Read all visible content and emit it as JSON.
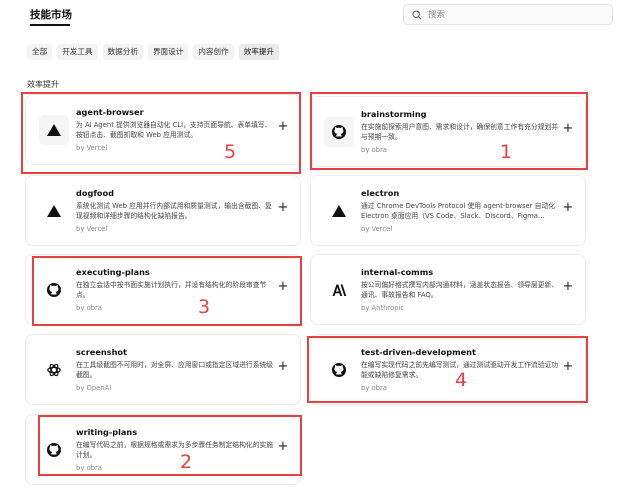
{
  "header": {
    "title": "技能市场"
  },
  "search": {
    "placeholder": "搜索",
    "icon": "search-icon"
  },
  "filters": [
    {
      "label": "全部",
      "active": false
    },
    {
      "label": "开发工具",
      "active": false
    },
    {
      "label": "数据分析",
      "active": false
    },
    {
      "label": "界面设计",
      "active": false
    },
    {
      "label": "内容创作",
      "active": false
    },
    {
      "label": "效率提升",
      "active": true
    }
  ],
  "section": {
    "label": "效率提升"
  },
  "cards": [
    {
      "name": "agent-browser",
      "desc": "为 AI Agent 提供浏览器自动化 CLI，支持页面导航、表单填写、按钮点击、截图抓取和 Web 应用测试。",
      "author": "by Vercel",
      "icon": "triangle-logo-icon",
      "add": "+"
    },
    {
      "name": "brainstorming",
      "desc": "在实施前探索用户意图、需求和设计，确保创意工作有充分规划并与预期一致。",
      "author": "by obra",
      "icon": "github-logo-icon",
      "add": "+"
    },
    {
      "name": "dogfood",
      "desc": "系统化测试 Web 应用并行内部试用和质量测试，输出含截图、复现视频和详细步骤的结构化缺陷报告。",
      "author": "by Vercel",
      "icon": "triangle-logo-icon",
      "add": "+"
    },
    {
      "name": "electron",
      "desc": "通过 Chrome DevTools Protocol 使用 agent-browser 自动化 Electron 桌面应用（VS Code、Slack、Discord、Figma…",
      "author": "by Vercel",
      "icon": "triangle-logo-icon",
      "add": "+"
    },
    {
      "name": "executing-plans",
      "desc": "在独立会话中按书面实施计划执行，并设有结构化的阶段审查节点。",
      "author": "by obra",
      "icon": "github-logo-icon",
      "add": "+"
    },
    {
      "name": "internal-comms",
      "desc": "按公司偏好格式撰写内部沟通材料，涵盖状态报告、领导层更新、通讯、事故报告和 FAQ。",
      "author": "by Anthropic",
      "icon": "anthropic-logo-icon",
      "add": "+"
    },
    {
      "name": "screenshot",
      "desc": "在工具级截图不可用时，对全屏、应用窗口或指定区域进行系统级截图。",
      "author": "by OpenAI",
      "icon": "openai-logo-icon",
      "add": "+"
    },
    {
      "name": "test-driven-development",
      "desc": "在编写实现代码之前先编写测试，通过测试驱动开发工作流验证功能或缺陷修复需求。",
      "author": "by obra",
      "icon": "github-logo-icon",
      "add": "+"
    },
    {
      "name": "writing-plans",
      "desc": "在编写代码之前，根据规格或需求为多步骤任务制定结构化的实施计划。",
      "author": "by obra",
      "icon": "github-logo-icon",
      "add": "+"
    }
  ],
  "annotations": [
    "5",
    "1",
    "3",
    "4",
    "2"
  ],
  "colors": {
    "highlight": "#e8403f",
    "chip_bg": "#f3f3f3",
    "border": "#ebebeb"
  }
}
